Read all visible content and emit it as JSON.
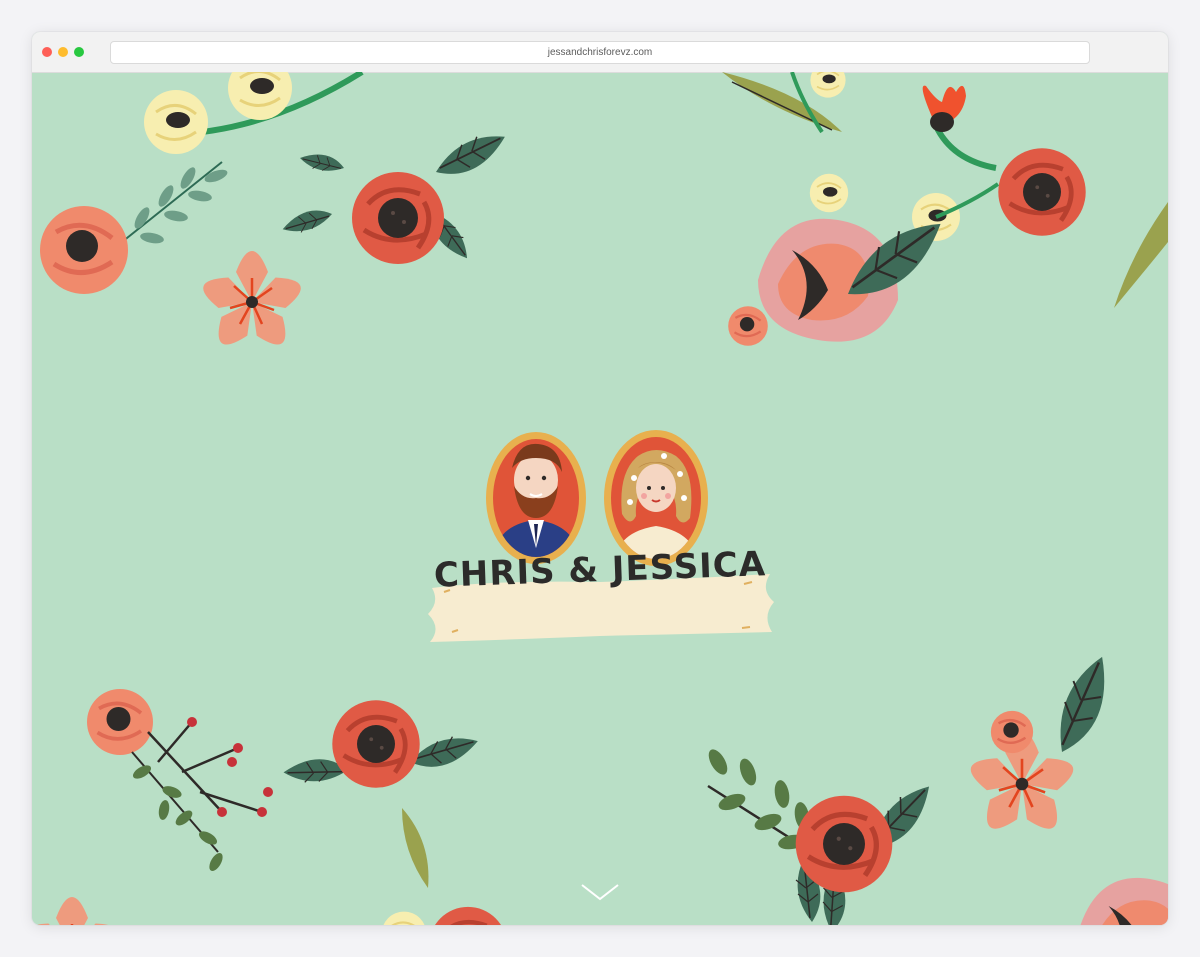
{
  "browser": {
    "url": "jessandchrisforevz.com",
    "traffic_lights": {
      "close": "#fe5f57",
      "minimize": "#febc2e",
      "zoom": "#28c840"
    }
  },
  "hero": {
    "couple_names": "CHRIS & JESSICA",
    "background_color": "#b9dfc6",
    "scroll_indicator_icon": "chevron-down-icon"
  },
  "colors": {
    "coral": "#f08a6c",
    "red_rose": "#e05a45",
    "peach_star": "#ee9b7e",
    "cream": "#f7eeb0",
    "dark_leaf": "#3e6b58",
    "olive_leaf": "#9aa24e",
    "stem_green": "#2f9a5a",
    "pink_petal": "#e6a2a0",
    "frame_gold": "#e8b04e",
    "portrait_bg": "#e05438",
    "banner": "#f7ecd0"
  }
}
